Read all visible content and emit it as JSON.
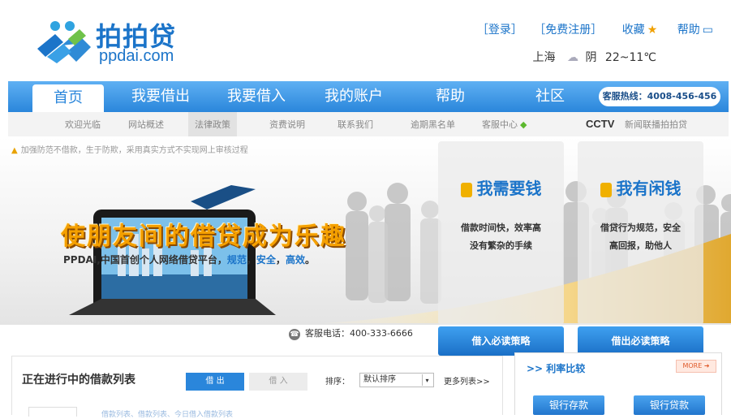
{
  "brand": {
    "name_cn": "拍拍贷",
    "name_en": "ppdai.com",
    "blue": "#1b74c9"
  },
  "toplinks": {
    "login": "［登录］",
    "register": "［免费注册］",
    "favorite": "收藏",
    "help": "帮助"
  },
  "weather": {
    "city": "上海",
    "condition": "阴",
    "temp": "22~11℃"
  },
  "nav": {
    "items": [
      "首页",
      "我要借出",
      "我要借入",
      "我的账户",
      "帮助",
      "社区"
    ],
    "hotline": "客服热线：4008-456-456"
  },
  "subnav": {
    "items": [
      "欢迎光临",
      "网站概述",
      "法律政策",
      "资费说明",
      "联系我们",
      "逾期黑名单",
      "客服中心"
    ],
    "cctv_logo": "CCTV",
    "cctv_text": "新闻联播拍拍贷"
  },
  "notice": "加强防范不借款，生于防欺，采用真实方式不实现网上审核过程",
  "banner": {
    "slogan": "使朋友间的借贷成为乐趣",
    "sub_prefix": "PPDAI,中国首创个人网络借贷平台，",
    "sub_h1": "规范",
    "sub_sep1": "，",
    "sub_h2": "安全",
    "sub_sep2": "，",
    "sub_h3": "高效",
    "sub_end": "。",
    "service_label": "客服电话：400-333-6666"
  },
  "cards": [
    {
      "title": "我需要钱",
      "desc1": "借款时间快，效率高",
      "desc2": "没有繁杂的手续",
      "button": "借入必读策略"
    },
    {
      "title": "我有闲钱",
      "desc1": "借贷行为规范，安全",
      "desc2": "高回报，助他人",
      "button": "借出必读策略"
    }
  ],
  "list": {
    "title": "正在进行中的借款列表",
    "tab_on": "借 出",
    "tab_off": "借 入",
    "sort_label": "排序：",
    "sort_value": "默认排序",
    "more": "更多列表>>",
    "row_text": "借款列表、借款列表、今日借入借款列表"
  },
  "rate": {
    "title": ">> 利率比较",
    "more": "MORE ➜",
    "btn_deposit": "银行存款",
    "btn_loan": "银行贷款"
  }
}
